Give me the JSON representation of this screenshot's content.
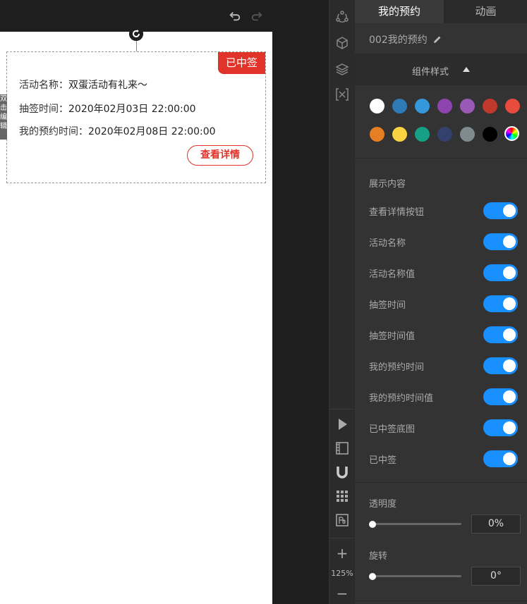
{
  "canvas": {
    "card": {
      "badge": "已中签",
      "rows": [
        {
          "label": "活动名称：",
          "value": "双蛋活动有礼来～"
        },
        {
          "label": "抽签时间：",
          "value": "2020年02月03日 22:00:00"
        },
        {
          "label": "我的预约时间：",
          "value": "2020年02月08日 22:00:00"
        }
      ],
      "detail_button": "查看详情"
    },
    "dblclick_tag": "双击编辑"
  },
  "toolbar": {
    "zoom_level": "125%",
    "zoom_plus": "+",
    "zoom_minus": "−"
  },
  "panel": {
    "tabs": [
      {
        "label": "我的预约",
        "active": true
      },
      {
        "label": "动画",
        "active": false
      }
    ],
    "component_name": "002我的预约",
    "style_section": "组件样式",
    "colors": [
      "#ffffff",
      "#2e7bb8",
      "#3498db",
      "#8e44ad",
      "#9b59b6",
      "#c0392b",
      "#e74c3c",
      "#e67e22",
      "#f9d342",
      "#16a085",
      "#34406e",
      "#7f8c8d",
      "#000000"
    ],
    "display_title": "展示内容",
    "toggles": [
      {
        "label": "查看详情按钮",
        "on": true
      },
      {
        "label": "活动名称",
        "on": true
      },
      {
        "label": "活动名称值",
        "on": true
      },
      {
        "label": "抽签时间",
        "on": true
      },
      {
        "label": "抽签时间值",
        "on": true
      },
      {
        "label": "我的预约时间",
        "on": true
      },
      {
        "label": "我的预约时间值",
        "on": true
      },
      {
        "label": "已中签底图",
        "on": true
      },
      {
        "label": "已中签",
        "on": true
      }
    ],
    "opacity": {
      "label": "透明度",
      "value": "0%"
    },
    "rotation": {
      "label": "旋转",
      "value": "0°"
    }
  }
}
